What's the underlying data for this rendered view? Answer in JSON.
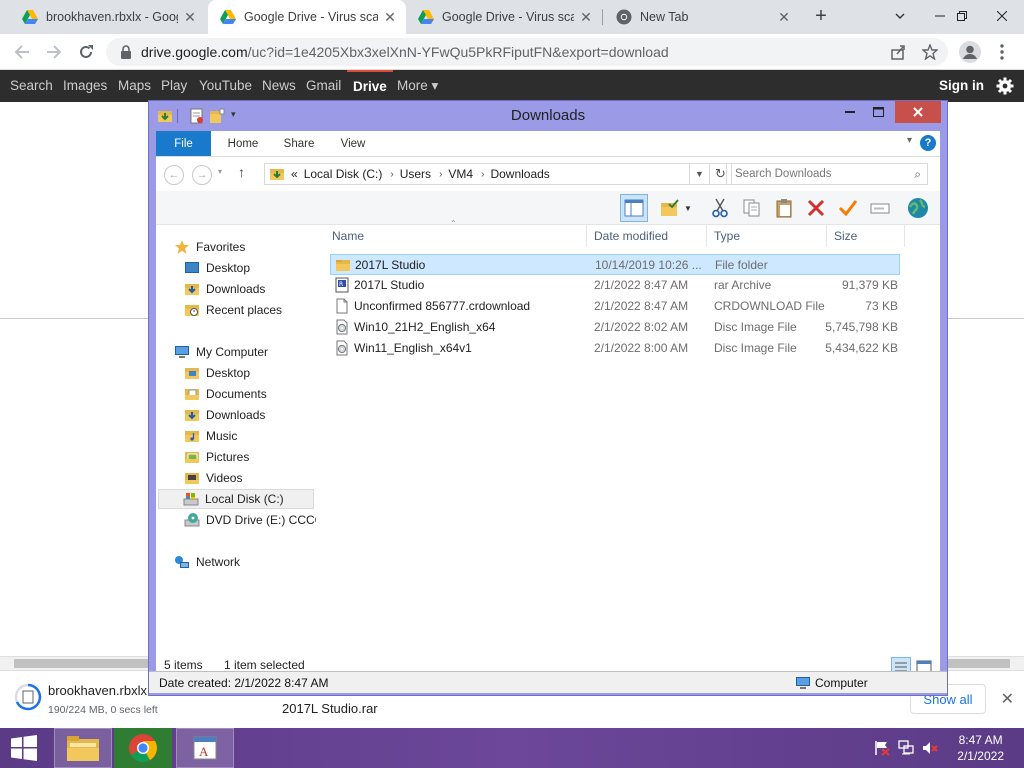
{
  "browser": {
    "tabs": [
      {
        "title": "brookhaven.rbxlx - Goog",
        "close": "✕",
        "icon": "google-drive-icon"
      },
      {
        "title": "Google Drive - Virus scan",
        "close": "✕",
        "icon": "google-drive-icon"
      },
      {
        "title": "Google Drive - Virus scan",
        "close": "✕",
        "icon": "google-drive-icon"
      },
      {
        "title": "New Tab",
        "close": "✕",
        "icon": "chrome-icon"
      }
    ],
    "new_tab": "+",
    "url_host": "drive.google.com",
    "url_path": "/uc?id=1e4205Xbx3xelXnN-YFwQu5PkRFiputFN&export=download"
  },
  "gbar": {
    "items": [
      "Search",
      "Images",
      "Maps",
      "Play",
      "YouTube",
      "News",
      "Gmail",
      "Drive",
      "More ▾"
    ],
    "selected": "Drive",
    "signin": "Sign in"
  },
  "explorer": {
    "title": "Downloads",
    "ribbon_tabs": [
      "File",
      "Home",
      "Share",
      "View"
    ],
    "help": "?",
    "address": {
      "prefix": "«",
      "crumbs": [
        "Local Disk (C:)",
        "Users",
        "VM4",
        "Downloads"
      ]
    },
    "search_placeholder": "Search Downloads",
    "nav": {
      "favorites": "Favorites",
      "fav_items": [
        "Desktop",
        "Downloads",
        "Recent places"
      ],
      "computer": "My Computer",
      "computer_items": [
        "Desktop",
        "Documents",
        "Downloads",
        "Music",
        "Pictures",
        "Videos",
        "Local Disk (C:)",
        "DVD Drive (E:) CCCC"
      ],
      "network": "Network"
    },
    "columns": [
      "Name",
      "Date modified",
      "Type",
      "Size"
    ],
    "files": [
      {
        "name": "2017L Studio",
        "date": "10/14/2019 10:26 ...",
        "type": "File folder",
        "size": "",
        "selected": true
      },
      {
        "name": "2017L Studio",
        "date": "2/1/2022 8:47 AM",
        "type": "rar Archive",
        "size": "91,379 KB"
      },
      {
        "name": "Unconfirmed 856777.crdownload",
        "date": "2/1/2022 8:47 AM",
        "type": "CRDOWNLOAD File",
        "size": "73 KB"
      },
      {
        "name": "Win10_21H2_English_x64",
        "date": "2/1/2022 8:02 AM",
        "type": "Disc Image File",
        "size": "5,745,798 KB"
      },
      {
        "name": "Win11_English_x64v1",
        "date": "2/1/2022 8:00 AM",
        "type": "Disc Image File",
        "size": "5,434,622 KB"
      }
    ],
    "status_items": "5 items",
    "status_selected": "1 item selected",
    "details_text": "Date created: 2/1/2022 8:47 AM",
    "details_location": "Computer"
  },
  "downloads": {
    "item1_name": "brookhaven.rbxlx",
    "item1_progress": "190/224 MB, 0 secs left",
    "item2_name": "2017L Studio.rar",
    "show_all": "Show all"
  },
  "taskbar": {
    "time": "8:47 AM",
    "date": "2/1/2022"
  }
}
